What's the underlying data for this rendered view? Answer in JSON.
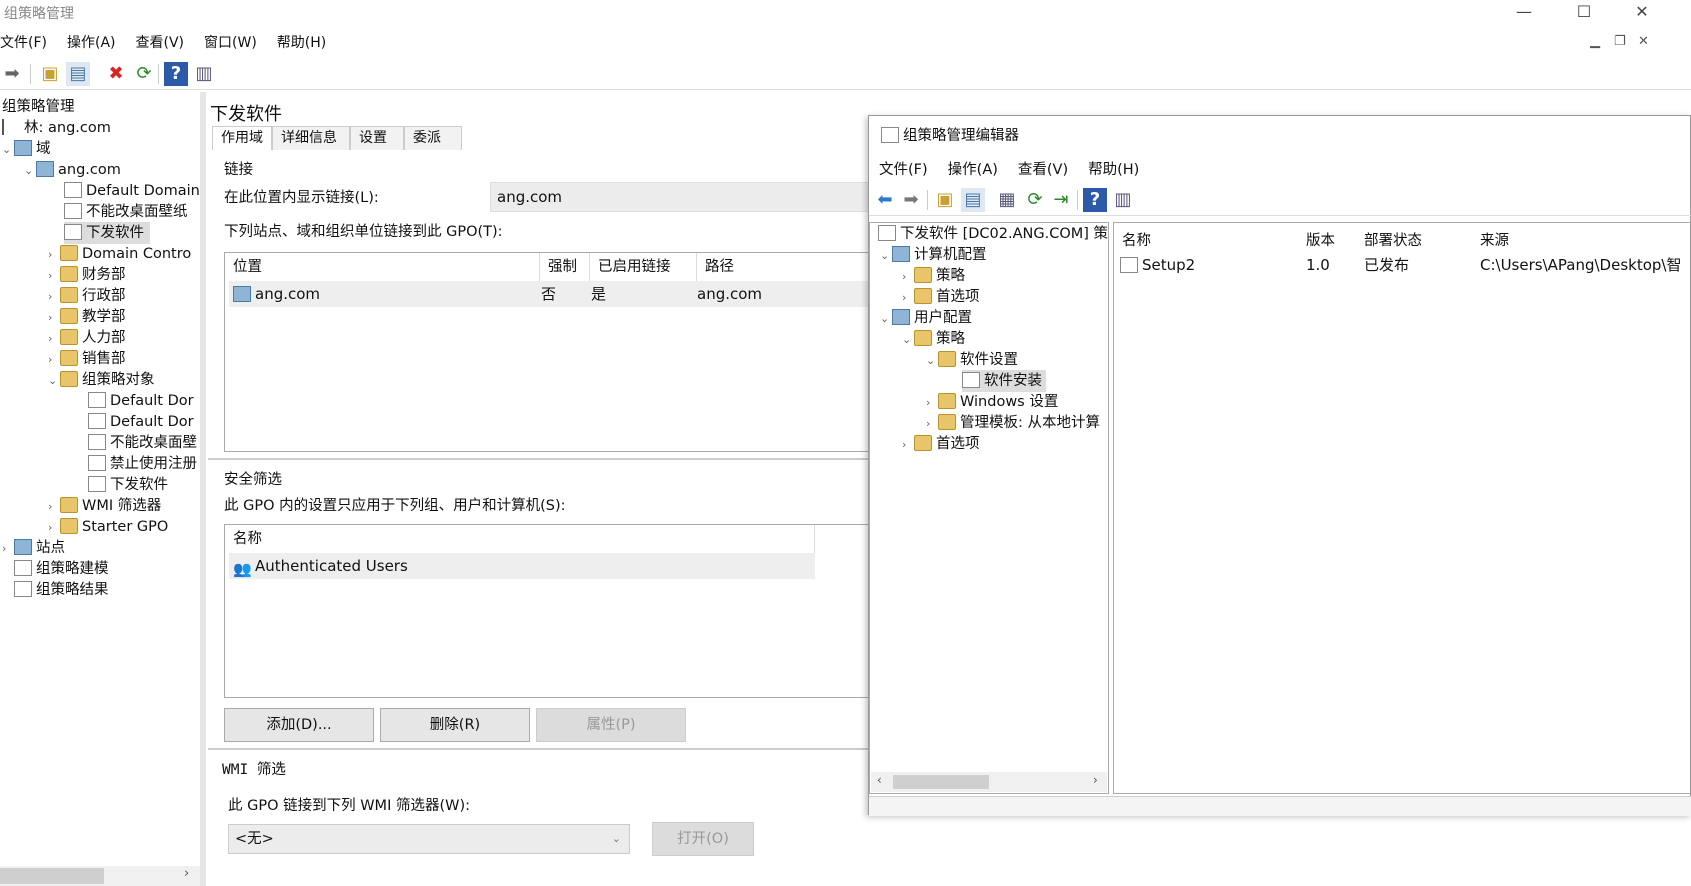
{
  "window": {
    "title": "组策略管理"
  },
  "menu": [
    "文件(F)",
    "操作(A)",
    "查看(V)",
    "窗口(W)",
    "帮助(H)"
  ],
  "tree": {
    "root": "组策略管理",
    "forest": "林: ang.com",
    "domains": "域",
    "domain": "ang.com",
    "items": [
      "Default Domain",
      "不能改桌面壁纸",
      "下发软件",
      "Domain Contro",
      "财务部",
      "行政部",
      "教学部",
      "人力部",
      "销售部",
      "组策略对象",
      "Default Dor",
      "Default Dor",
      "不能改桌面壁",
      "禁止使用注册",
      "下发软件",
      "WMI 筛选器",
      "Starter GPO"
    ],
    "sites": "站点",
    "modeling": "组策略建模",
    "results": "组策略结果"
  },
  "panel": {
    "title": "下发软件",
    "tabs": [
      "作用域",
      "详细信息",
      "设置",
      "委派"
    ],
    "links_heading": "链接",
    "show_links_label": "在此位置内显示链接(L):",
    "show_links_value": "ang.com",
    "linked_label": "下列站点、域和组织单位链接到此 GPO(T):",
    "links_columns": [
      "位置",
      "强制",
      "已启用链接",
      "路径"
    ],
    "links_rows": [
      {
        "location": "ang.com",
        "enforced": "否",
        "enabled": "是",
        "path": "ang.com"
      }
    ],
    "security_heading": "安全筛选",
    "security_label": "此 GPO 内的设置只应用于下列组、用户和计算机(S):",
    "security_column": "名称",
    "security_rows": [
      "Authenticated Users"
    ],
    "btn_add": "添加(D)...",
    "btn_remove": "删除(R)",
    "btn_props": "属性(P)",
    "wmi_heading": "WMI 筛选",
    "wmi_label": "此 GPO 链接到下列 WMI 筛选器(W):",
    "wmi_value": "<无>",
    "wmi_open": "打开(O)"
  },
  "editor": {
    "title": "组策略管理编辑器",
    "menu": [
      "文件(F)",
      "操作(A)",
      "查看(V)",
      "帮助(H)"
    ],
    "tree_root": "下发软件 [DC02.ANG.COM] 策",
    "computer_config": "计算机配置",
    "cc_policies": "策略",
    "cc_prefs": "首选项",
    "user_config": "用户配置",
    "uc_policies": "策略",
    "software_settings": "软件设置",
    "software_install": "软件安装",
    "windows_settings": "Windows 设置",
    "admin_templates": "管理模板: 从本地计算",
    "uc_prefs": "首选项",
    "columns": [
      "名称",
      "版本",
      "部署状态",
      "来源"
    ],
    "rows": [
      {
        "name": "Setup2",
        "version": "1.0",
        "status": "已发布",
        "source": "C:\\Users\\APang\\Desktop\\智"
      }
    ]
  }
}
